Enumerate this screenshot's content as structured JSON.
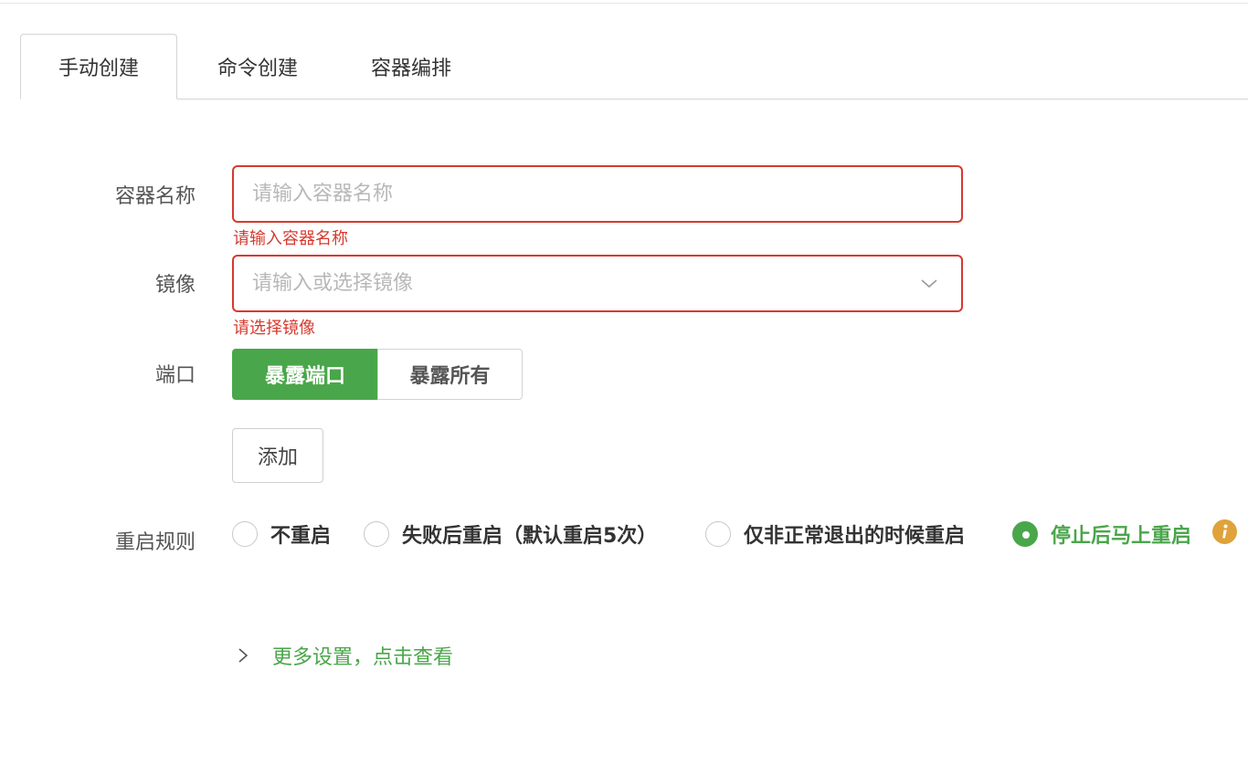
{
  "tabs": [
    {
      "label": "手动创建",
      "active": true
    },
    {
      "label": "命令创建",
      "active": false
    },
    {
      "label": "容器编排",
      "active": false
    }
  ],
  "form": {
    "name": {
      "label": "容器名称",
      "value": "",
      "placeholder": "请输入容器名称",
      "error": "请输入容器名称"
    },
    "image": {
      "label": "镜像",
      "value": "",
      "placeholder": "请输入或选择镜像",
      "error": "请选择镜像"
    },
    "port": {
      "label": "端口",
      "options": [
        "暴露端口",
        "暴露所有"
      ],
      "selected": "暴露端口",
      "add_label": "添加"
    },
    "restart": {
      "label": "重启规则",
      "options": [
        "不重启",
        "失败后重启（默认重启5次）",
        "仅非正常退出的时候重启",
        "停止后马上重启"
      ],
      "selected": "停止后马上重启"
    },
    "more_link": "更多设置，点击查看"
  },
  "colors": {
    "accent": "#4aa64a",
    "error": "#d63a2f",
    "info": "#e0a23a"
  },
  "icons": {
    "select_chevron": "chevron-down-icon",
    "info": "info-icon",
    "expand": "chevron-right-icon"
  }
}
